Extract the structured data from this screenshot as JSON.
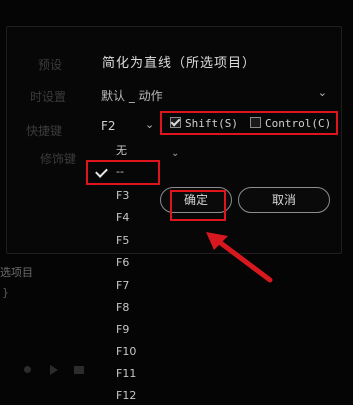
{
  "background": {
    "labels": [
      "预设",
      "时设置",
      "快捷键",
      "修饰键"
    ],
    "lower_text": "选项目",
    "lower_text2": "}"
  },
  "dialog": {
    "title": "简化为直线（所选项目）",
    "dropdown_value": "默认 _ 动作",
    "key_value": "F2",
    "modifiers": {
      "shift_label": "Shift(S)",
      "shift_checked": true,
      "control_label": "Control(C)",
      "control_checked": false
    },
    "buttons": {
      "ok": "确定",
      "cancel": "取消"
    }
  },
  "key_list": {
    "items": [
      "无",
      "--",
      "F3",
      "F4",
      "F5",
      "F6",
      "F7",
      "F8",
      "F9",
      "F10",
      "F11",
      "F12"
    ],
    "selected_index": 1
  },
  "annotation_color": "#e0141c"
}
